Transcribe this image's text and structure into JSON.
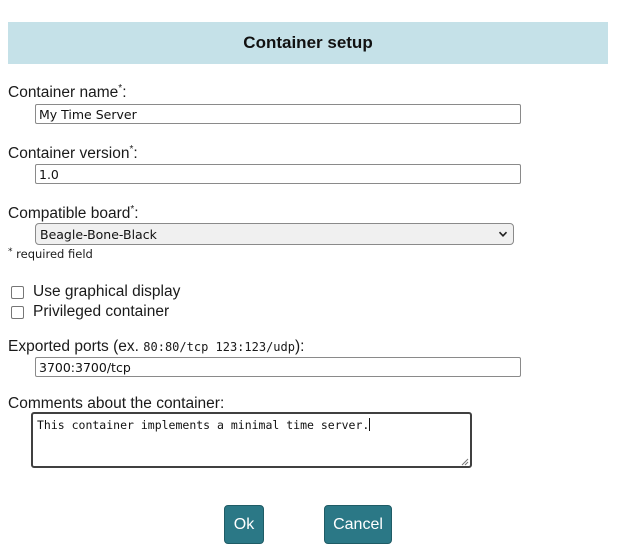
{
  "header": {
    "title": "Container setup"
  },
  "fields": {
    "name": {
      "label": "Container name",
      "required_mark": "*",
      "suffix": ":",
      "value": "My Time Server"
    },
    "version": {
      "label": "Container version",
      "required_mark": "*",
      "suffix": ":",
      "value": "1.0"
    },
    "board": {
      "label": "Compatible board",
      "required_mark": "*",
      "suffix": ":",
      "selected": "Beagle-Bone-Black",
      "icon": "chevron-down-icon"
    }
  },
  "required_note": {
    "mark": "*",
    "text": " required field"
  },
  "checkboxes": [
    {
      "label": "Use graphical display",
      "checked": false
    },
    {
      "label": "Privileged container",
      "checked": false
    }
  ],
  "ports": {
    "label_prefix": "Exported ports (ex. ",
    "example": "80:80/tcp 123:123/udp",
    "label_suffix": "):",
    "value": "3700:3700/tcp"
  },
  "comments": {
    "label": "Comments about the container:",
    "value": "This container implements a minimal time server."
  },
  "buttons": {
    "ok": "Ok",
    "cancel": "Cancel"
  },
  "colors": {
    "header_bg": "#c5e1e8",
    "button_bg": "#2b7886"
  }
}
